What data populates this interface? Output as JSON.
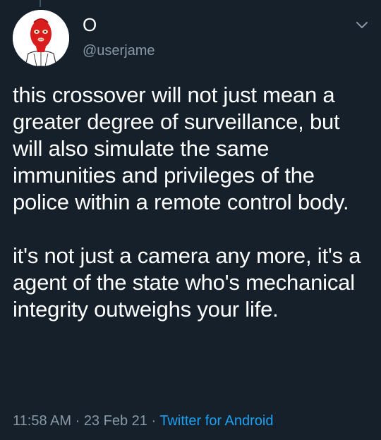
{
  "tweet": {
    "display_name": "O",
    "handle": "@userjame",
    "paragraphs": [
      "this crossover will not just mean a greater degree of surveillance, but will also simulate the same immunities and privileges of the police within a remote control body.",
      "it's not just a camera any more, it's a agent of the state who's mechanical integrity outweighs your life."
    ],
    "time": "11:58 AM",
    "date": "23 Feb 21",
    "source": "Twitter for Android",
    "separator": " · "
  },
  "icons": {
    "avatar": "red-balaclava-avatar",
    "menu": "chevron-down-icon"
  },
  "colors": {
    "background": "#15202b",
    "text": "#ffffff",
    "muted": "#8899a6",
    "link": "#1da1f2",
    "avatar_mask": "#d91c1c"
  }
}
